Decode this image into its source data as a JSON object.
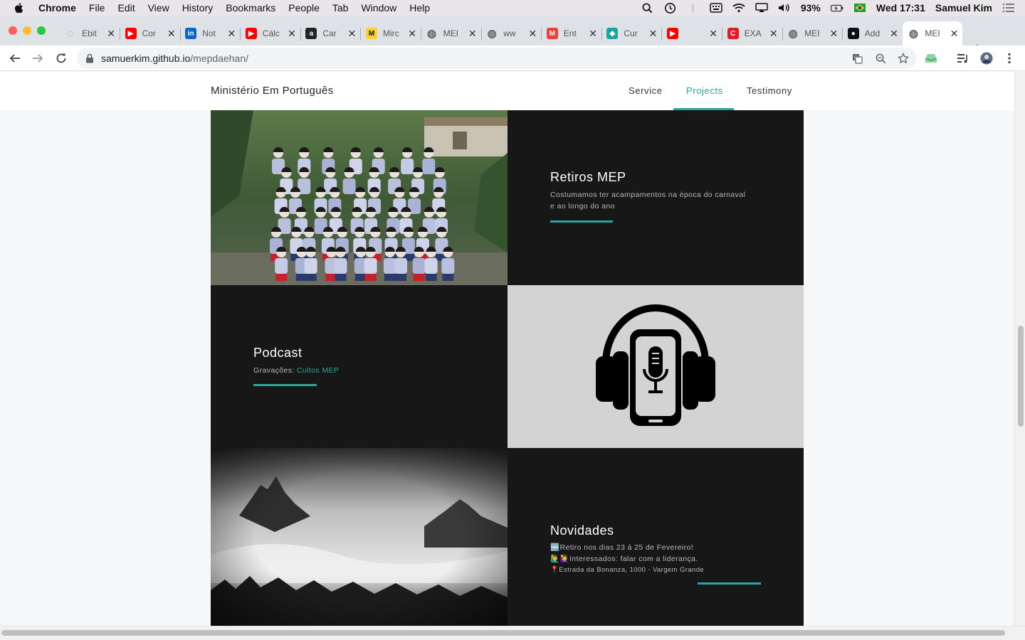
{
  "menubar": {
    "app": "Chrome",
    "items": [
      "File",
      "Edit",
      "View",
      "History",
      "Bookmarks",
      "People",
      "Tab",
      "Window",
      "Help"
    ],
    "battery": "93%",
    "clock": "Wed 17:31",
    "user": "Samuel Kim"
  },
  "tabs": [
    {
      "title": "Ebit",
      "favicon": "loading-icon",
      "color": "#9aa0a6"
    },
    {
      "title": "Cor",
      "favicon": "youtube-icon",
      "color": "#ff0000"
    },
    {
      "title": "Not",
      "favicon": "linkedin-icon",
      "color": "#0a66c2"
    },
    {
      "title": "Cálc",
      "favicon": "youtube-icon",
      "color": "#ff0000"
    },
    {
      "title": "Car",
      "favicon": "amazon-icon",
      "color": "#222222"
    },
    {
      "title": "Mirc",
      "favicon": "miro-icon",
      "color": "#ffd02f"
    },
    {
      "title": "MEI",
      "favicon": "globe-icon",
      "color": "#5f6368"
    },
    {
      "title": "ww",
      "favicon": "globe-icon",
      "color": "#5f6368"
    },
    {
      "title": "Ent",
      "favicon": "gmail-icon",
      "color": "#ea4335"
    },
    {
      "title": "Cur",
      "favicon": "course-icon",
      "color": "#1aa3a3"
    },
    {
      "title": "",
      "favicon": "youtube-icon",
      "color": "#ff0000"
    },
    {
      "title": "EXA",
      "favicon": "exa-icon",
      "color": "#e31b23"
    },
    {
      "title": "MEI",
      "favicon": "globe-icon",
      "color": "#5f6368"
    },
    {
      "title": "Add",
      "favicon": "github-icon",
      "color": "#111111"
    },
    {
      "title": "MEI",
      "favicon": "globe-icon",
      "color": "#5f6368"
    }
  ],
  "address": {
    "domain": "samuerkim.github.io",
    "path": "/mepdaehan/"
  },
  "site": {
    "brand": "Ministério Em Português",
    "nav": [
      "Service",
      "Projects",
      "Testimony"
    ],
    "accent": "#2ea59c"
  },
  "projects": {
    "retiros": {
      "title": "Retiros MEP",
      "text_line1": "Costumamos ter acampamentos na época do carnaval",
      "text_line2": "e ao longo do ano"
    },
    "podcast": {
      "title": "Podcast",
      "label": "Gravações: ",
      "link": "Cultos MEP"
    },
    "novidades": {
      "title": "Novidades",
      "line1": "🆕Retiro nos dias 23 à 25 de Fevereiro!",
      "line2": "🙋‍♂️🙋‍♀️Interessados: falar com a liderança.",
      "line3": "📍Estrada da Bonanza, 1000 - Vargem Grande"
    }
  }
}
